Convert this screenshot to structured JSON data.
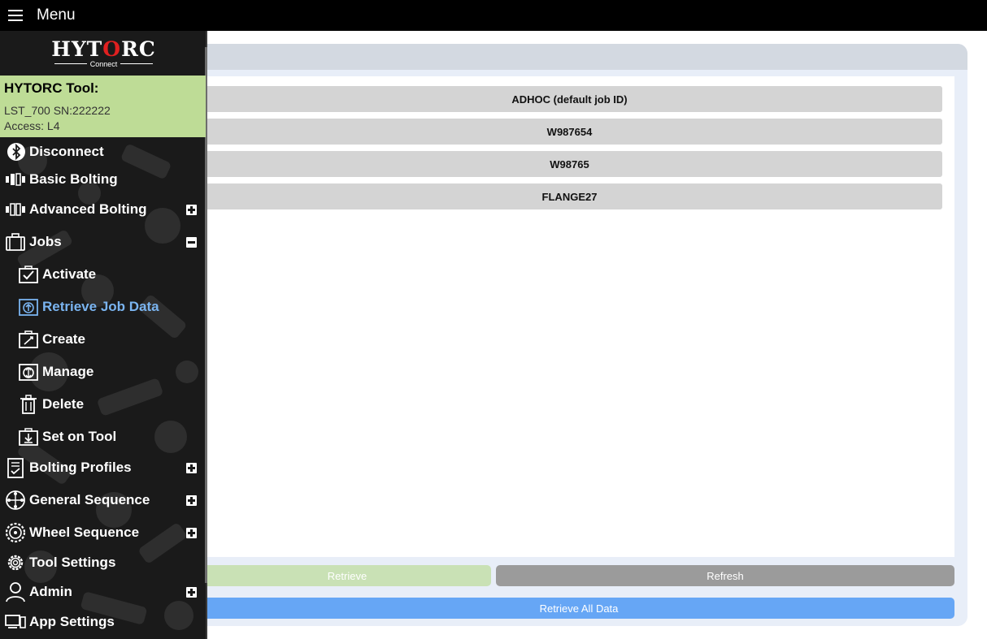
{
  "topbar": {
    "menu_label": "Menu"
  },
  "logo": {
    "brand": "HYTORC",
    "sub": "Connect"
  },
  "tool": {
    "heading": "HYTORC Tool:",
    "model": "LST_700 SN:222222",
    "access": "Access: L4"
  },
  "nav": {
    "disconnect": "Disconnect",
    "basic_bolting": "Basic Bolting",
    "advanced_bolting": "Advanced Bolting",
    "jobs": "Jobs",
    "activate": "Activate",
    "retrieve_job_data": "Retrieve Job Data",
    "create": "Create",
    "manage": "Manage",
    "delete": "Delete",
    "set_on_tool": "Set on Tool",
    "bolting_profiles": "Bolting Profiles",
    "general_sequence": "General Sequence",
    "wheel_sequence": "Wheel Sequence",
    "tool_settings": "Tool Settings",
    "admin": "Admin",
    "app_settings": "App Settings"
  },
  "jobs": [
    {
      "label": "ADHOC (default job ID)"
    },
    {
      "label": "W987654"
    },
    {
      "label": "W98765"
    },
    {
      "label": "FLANGE27"
    }
  ],
  "buttons": {
    "retrieve": "Retrieve",
    "refresh": "Refresh",
    "retrieve_all": "Retrieve All Data"
  },
  "colors": {
    "active_nav": "#7ab4f0",
    "tool_box": "#bedc96",
    "retrieve_all": "#66a6f5",
    "refresh": "#9b9b9b",
    "retrieve_disabled": "#c9e1b5"
  }
}
